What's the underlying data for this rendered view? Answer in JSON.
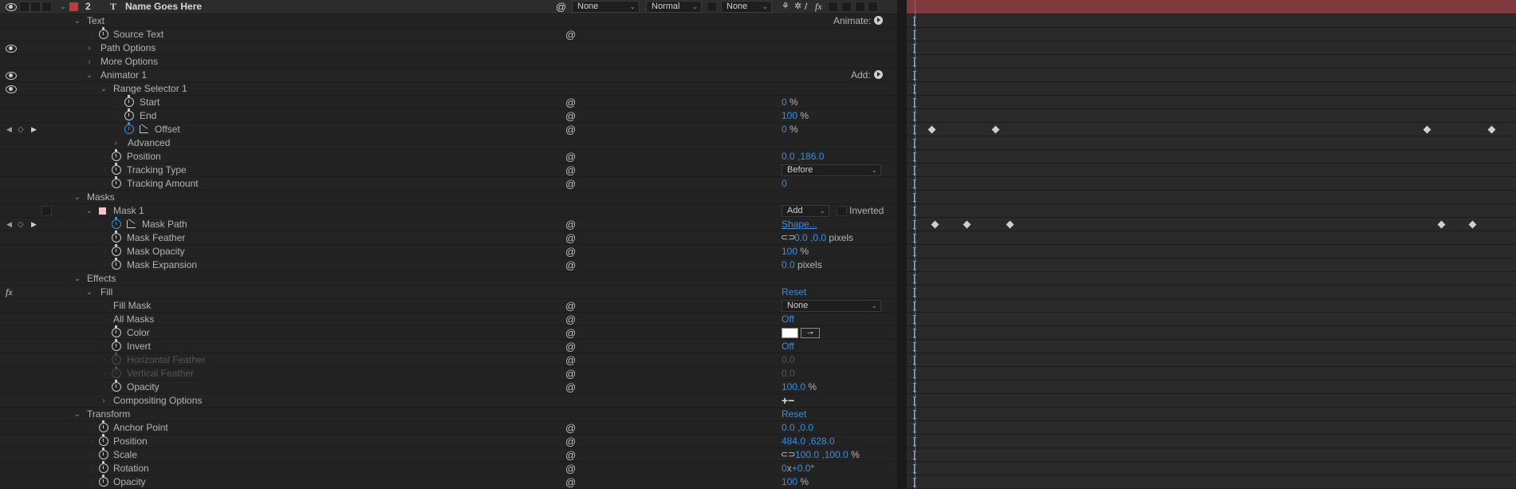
{
  "layer": {
    "number": "2",
    "name": "Name Goes Here",
    "color": "#c0393b",
    "parent_value": "None",
    "mode_value": "Normal",
    "matte_value": "None",
    "switch_icons": [
      "shy-icon",
      "collapse-icon",
      "quality-icon",
      "fx-icon"
    ]
  },
  "rows": {
    "text": "Text",
    "animate_label": "Animate:",
    "source_text": "Source Text",
    "path_options": "Path Options",
    "more_options": "More Options",
    "animator": "Animator 1",
    "add_label": "Add:",
    "range_selector": "Range Selector 1",
    "start": {
      "label": "Start",
      "value": "0",
      "unit": "%"
    },
    "end": {
      "label": "End",
      "value": "100",
      "unit": "%"
    },
    "offset": {
      "label": "Offset",
      "value": "0",
      "unit": "%"
    },
    "advanced": "Advanced",
    "anim_position": {
      "label": "Position",
      "value": "0.0 ,186.0"
    },
    "tracking_type": {
      "label": "Tracking Type",
      "value": "Before"
    },
    "tracking_amount": {
      "label": "Tracking Amount",
      "value": "0"
    },
    "masks": "Masks",
    "mask1": {
      "label": "Mask 1",
      "mode": "Add",
      "inverted": "Inverted",
      "color": "#f2c4cb"
    },
    "mask_path": {
      "label": "Mask Path",
      "value": "Shape..."
    },
    "mask_feather": {
      "label": "Mask Feather",
      "value": "0.0 ,0.0",
      "unit": "pixels"
    },
    "mask_opacity": {
      "label": "Mask Opacity",
      "value": "100",
      "unit": "%"
    },
    "mask_expansion": {
      "label": "Mask Expansion",
      "value": "0.0",
      "unit": "pixels"
    },
    "effects": "Effects",
    "fill": {
      "label": "Fill",
      "reset": "Reset"
    },
    "fill_mask": {
      "label": "Fill Mask",
      "value": "None"
    },
    "all_masks": {
      "label": "All Masks",
      "value": "Off"
    },
    "color": {
      "label": "Color"
    },
    "invert": {
      "label": "Invert",
      "value": "Off"
    },
    "h_feather": {
      "label": "Horizontal Feather",
      "value": "0.0"
    },
    "v_feather": {
      "label": "Vertical Feather",
      "value": "0.0"
    },
    "fill_opacity": {
      "label": "Opacity",
      "value": "100.0",
      "unit": "%"
    },
    "compositing": {
      "label": "Compositing Options",
      "value": "+−"
    },
    "transform": {
      "label": "Transform",
      "reset": "Reset"
    },
    "anchor": {
      "label": "Anchor Point",
      "value": "0.0 ,0.0"
    },
    "position": {
      "label": "Position",
      "value": "484.0 ,628.0"
    },
    "scale": {
      "label": "Scale",
      "value": "100.0 ,100.0",
      "unit": "%"
    },
    "rotation": {
      "label": "Rotation",
      "value": "0",
      "x": "x",
      "deg": "+0.0",
      "unit": "°"
    },
    "opacity": {
      "label": "Opacity",
      "value": "100",
      "unit": "%"
    }
  },
  "colors": {
    "value_blue": "#3b8de0",
    "layer_bar": "#7e3a3d",
    "panel_bg": "#232323"
  }
}
